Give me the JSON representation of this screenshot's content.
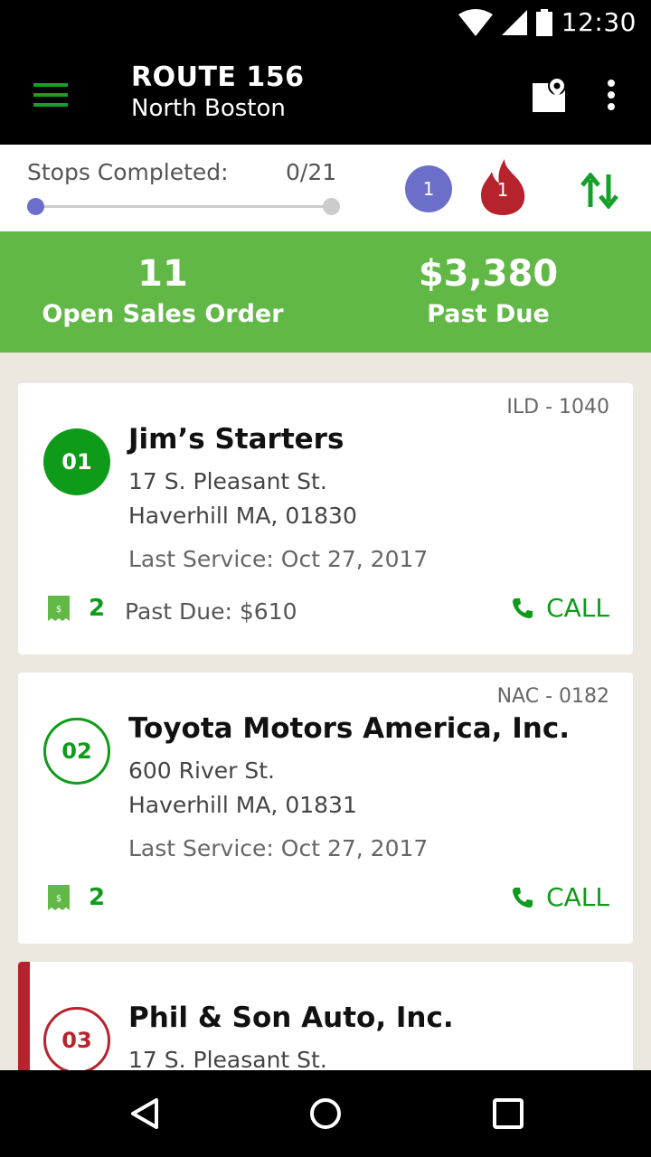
{
  "status_bar": {
    "time": "12:30"
  },
  "app_bar": {
    "title": "ROUTE 156",
    "subtitle": "North Boston"
  },
  "progress": {
    "label": "Stops Completed:",
    "count": "0/21",
    "fraction": 0,
    "badge_count": "1",
    "alert_count": "1"
  },
  "summary": {
    "left_value": "11",
    "left_label": "Open Sales Order",
    "right_value": "$3,380",
    "right_label": "Past Due"
  },
  "colors": {
    "green": "#0e9b1a",
    "summary_green": "#62b847",
    "red": "#b7232d",
    "purple": "#6b6fc9"
  },
  "stops": [
    {
      "number": "01",
      "code": "ILD - 1040",
      "name": "Jim’s Starters",
      "address1": "17 S. Pleasant St.",
      "address2": "Haverhill MA, 01830",
      "last_service": "Last Service: Oct 27, 2017",
      "receipt_count": "2",
      "past_due": "Past Due: $610",
      "call_label": "CALL"
    },
    {
      "number": "02",
      "code": "NAC - 0182",
      "name": "Toyota Motors America, Inc.",
      "address1": "600 River St.",
      "address2": "Haverhill MA, 01831",
      "last_service": "Last Service: Oct 27, 2017",
      "receipt_count": "2",
      "call_label": "CALL"
    },
    {
      "number": "03",
      "name": "Phil & Son Auto, Inc.",
      "address1": "17 S. Pleasant St."
    }
  ]
}
